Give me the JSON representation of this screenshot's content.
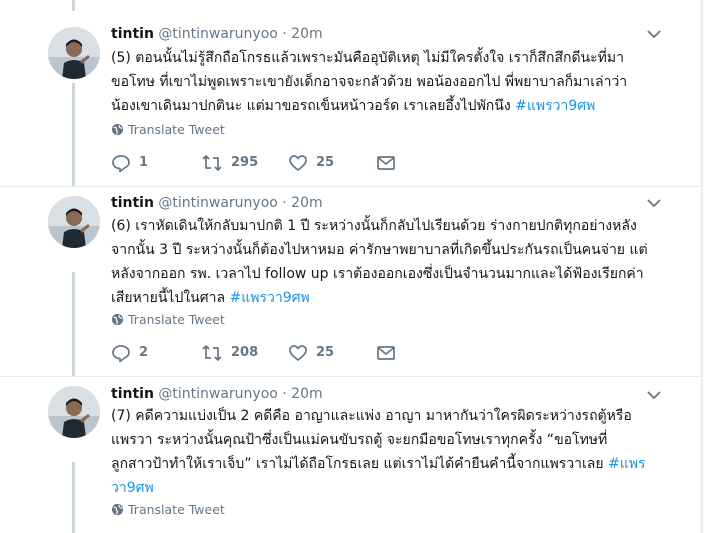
{
  "tweets": [
    {
      "name": "tintin",
      "handle": "@tintinwarunyoo",
      "time": "· 20m",
      "lines": [
        "(5) ตอนนั้นไม่รู้สึกถือโกรธแล้วเพราะมันคืออุบัติเหตุ ไม่มีใครตั้งใจ เราก็สึกสึกดีนะที่มา",
        "ขอโทษ ที่เขาไม่พูดเพราะเขายังเด็กอาจจะกลัวด้วย พอน้องออกไป พี่พยาบาลก็มาเล่าว่า",
        "น้องเขาเดินมาปกตินะ แต่มาขอรถเข็นหน้าวอร์ด  เราเลยอึ้งไปพักนึง "
      ],
      "hashtag": "#แพรวา9ศพ",
      "translate": "Translate Tweet",
      "replies": "1",
      "retweets": "295",
      "likes": "25"
    },
    {
      "name": "tintin",
      "handle": "@tintinwarunyoo",
      "time": "· 20m",
      "lines": [
        "(6) เราหัดเดินให้กลับมาปกติ 1 ปี ระหว่างนั้นก็กลับไปเรียนด้วย ร่างกายปกติทุกอย่างหลัง",
        "จากนั้น 3 ปี ระหว่างนั้นก็ต้องไปหาหมอ  ค่ารักษาพยาบาลที่เกิดขึ้นประกันรถเป็นคนจ่าย แต่",
        "หลังจากออก รพ. เวลาไป follow up เราต้องออกเองซึ่งเป็นจำนวนมากและได้ฟ้องเรียกค่า",
        "เสียหายนี้ไปในศาล "
      ],
      "hashtag": "#แพรวา9ศพ",
      "translate": "Translate Tweet",
      "replies": "2",
      "retweets": "208",
      "likes": "25"
    },
    {
      "name": "tintin",
      "handle": "@tintinwarunyoo",
      "time": "· 20m",
      "lines": [
        "(7) คดีความแบ่งเป็น 2 คดีคือ  อาญาและแพ่ง อาญา มาหากันว่าใครผิดระหว่างรถตู้หรือ",
        "แพรวา ระหว่างนั้นคุณป้าซึ่งเป็นแม่คนขับรถตู้ จะยกมือขอโทษเราทุกครั้ง “ขอโทษที่",
        "ลูกสาวป้าทำให้เราเจ็บ” เราไม่ได้ถือโกรธเลย  แต่เราไม่ได้คำยืนคำนี้จากแพรวาเลย ",
        ""
      ],
      "hashtag_parts": [
        "#แพร",
        "วา9ศพ"
      ],
      "translate": "Translate Tweet"
    }
  ],
  "colors": {
    "accent": "#1b95e0",
    "muted": "#657786",
    "thread_line": "#ccd6dd"
  },
  "icons": [
    "caret-down-icon",
    "globe-icon",
    "reply-icon",
    "retweet-icon",
    "like-icon",
    "message-icon"
  ]
}
